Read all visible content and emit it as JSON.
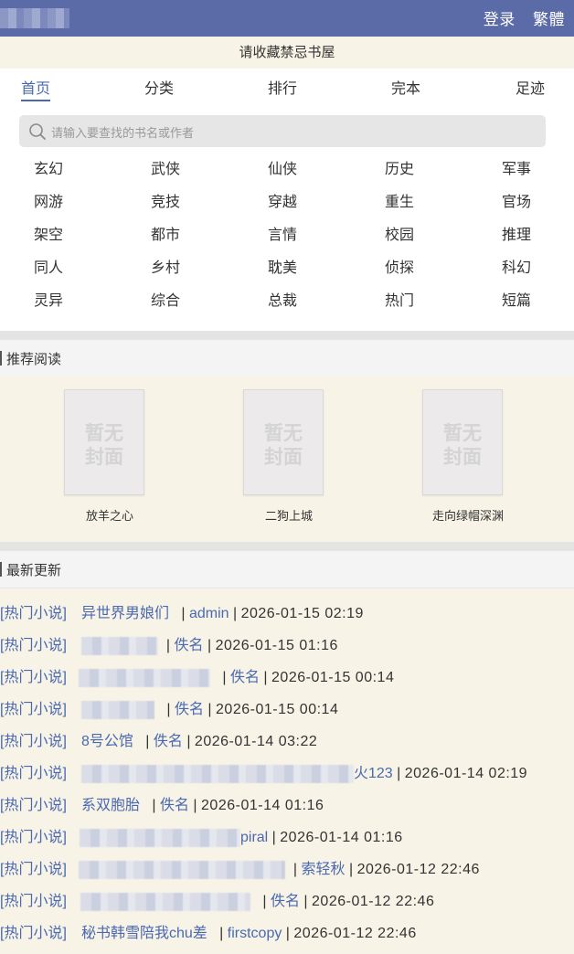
{
  "header": {
    "site_name": "",
    "login": "登录",
    "traditional": "繁體"
  },
  "notice": "请收藏禁忌书屋",
  "tabs": [
    "首页",
    "分类",
    "排行",
    "完本",
    "足迹"
  ],
  "search": {
    "placeholder": "请输入要查找的书名或作者"
  },
  "categories": [
    [
      "玄幻",
      "武侠",
      "仙侠",
      "历史",
      "军事"
    ],
    [
      "网游",
      "竞技",
      "穿越",
      "重生",
      "官场"
    ],
    [
      "架空",
      "都市",
      "言情",
      "校园",
      "推理"
    ],
    [
      "同人",
      "乡村",
      "耽美",
      "侦探",
      "科幻"
    ],
    [
      "灵异",
      "综合",
      "总裁",
      "热门",
      "短篇"
    ]
  ],
  "recommend": {
    "title": "推荐阅读",
    "cover_text": "暂无封面",
    "books": [
      "放羊之心",
      "二狗上城",
      "走向绿帽深渊"
    ]
  },
  "latest": {
    "title": "最新更新",
    "tag": "[热门小说]",
    "rows": [
      {
        "book": "异世界男娘们",
        "author": "admin",
        "time": "2026-01-15 02:19"
      },
      {
        "book": "",
        "author": "佚名",
        "time": "2026-01-15 01:16"
      },
      {
        "book": "",
        "author": "佚名",
        "time": "2026-01-15 00:14"
      },
      {
        "book": "",
        "author": "佚名",
        "time": "2026-01-15 00:14"
      },
      {
        "book": "8号公馆",
        "author": "佚名",
        "time": "2026-01-14 03:22"
      },
      {
        "book": "",
        "author": "火123",
        "time": "2026-01-14 02:19"
      },
      {
        "book": "系双胞胎",
        "author": "佚名",
        "time": "2026-01-14 01:16"
      },
      {
        "book": "",
        "author": "piral",
        "time": "2026-01-14 01:16"
      },
      {
        "book": "",
        "author": "索轻秋",
        "time": "2026-01-12 22:46"
      },
      {
        "book": "",
        "author": "佚名",
        "time": "2026-01-12 22:46"
      },
      {
        "book": "秘书韩雪陪我chu差",
        "author": "firstcopy",
        "time": "2026-01-12 22:46"
      }
    ]
  },
  "colors": {
    "header": "#5b6ba7",
    "accent": "#4a69b0",
    "background": "#f7f3e6"
  },
  "icons": {
    "search": "search-icon"
  }
}
